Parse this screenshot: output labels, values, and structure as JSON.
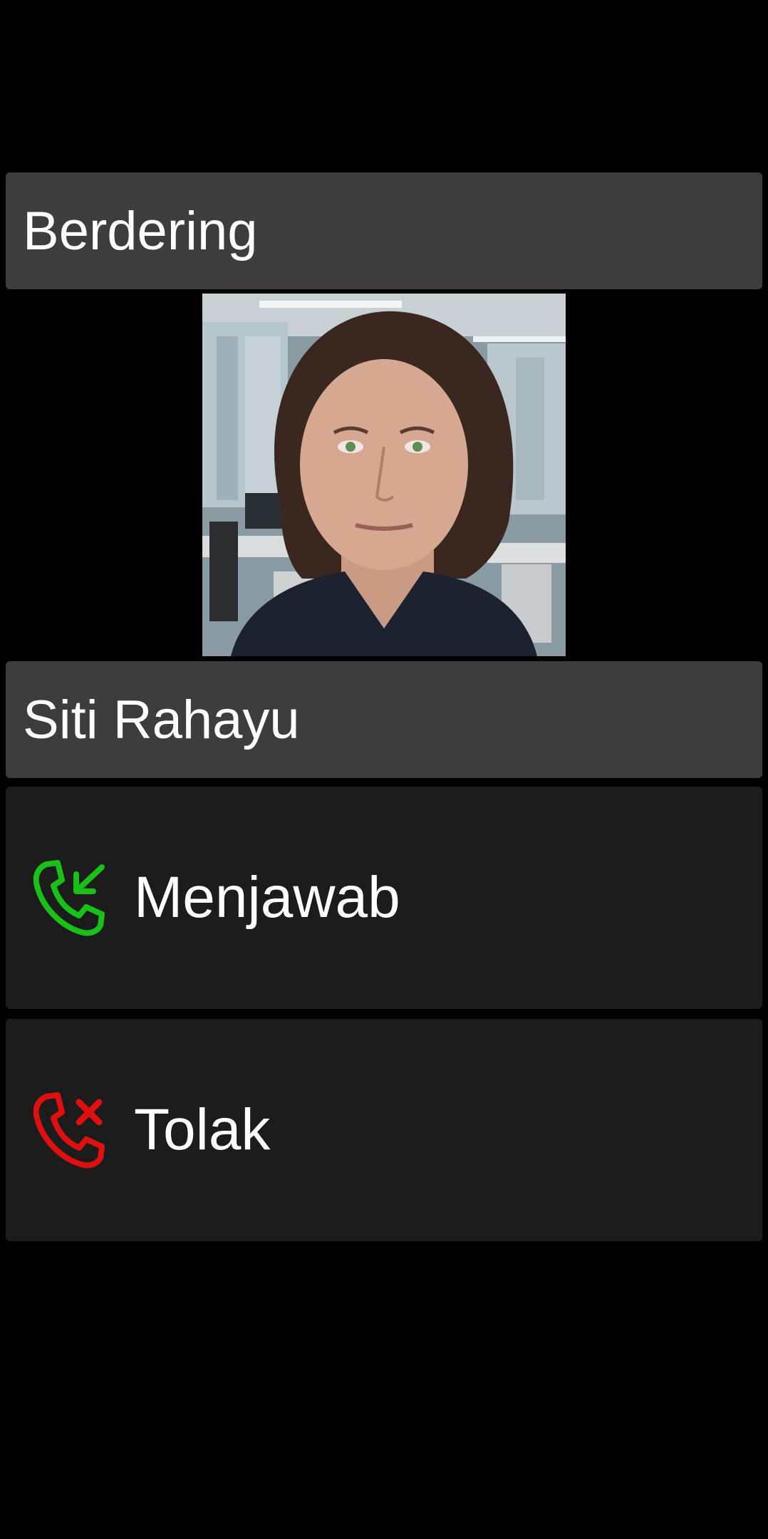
{
  "call": {
    "status": "Berdering",
    "caller_name": "Siti Rahayu"
  },
  "actions": {
    "answer": {
      "label": "Menjawab",
      "icon": "call-answer-icon",
      "color": "#18c018"
    },
    "decline": {
      "label": "Tolak",
      "icon": "call-decline-icon",
      "color": "#e01010"
    }
  },
  "colors": {
    "background": "#000000",
    "header_bar": "#3d3d3d",
    "action_bar": "#1c1c1c",
    "text": "#ffffff"
  }
}
